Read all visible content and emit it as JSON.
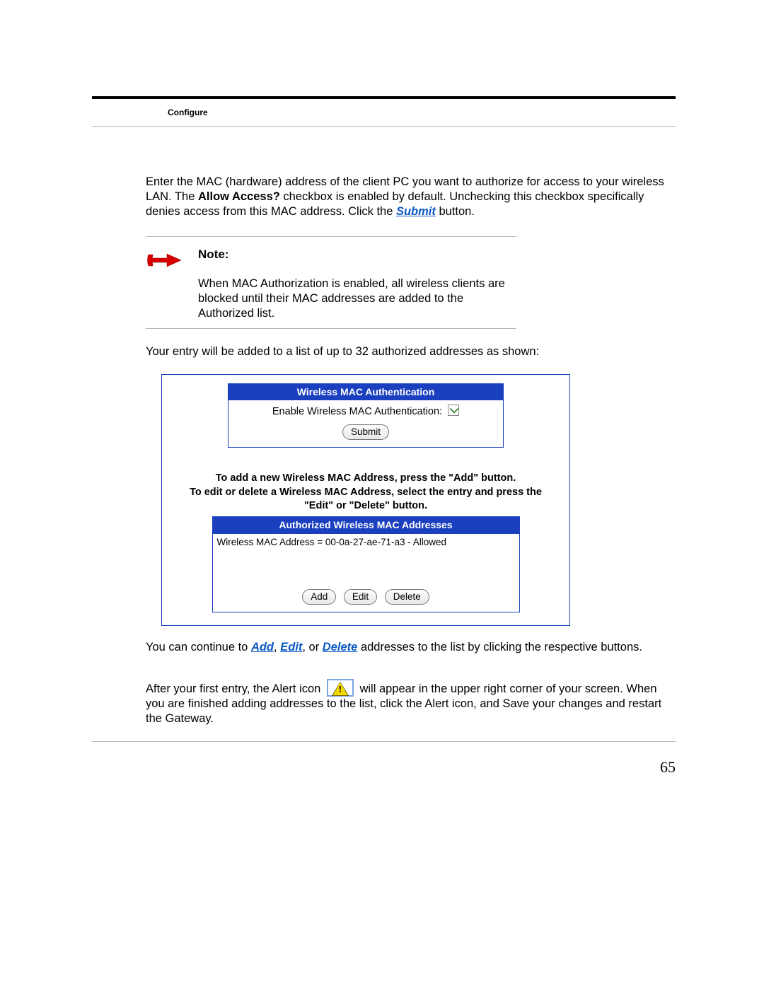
{
  "header": {
    "section": "Configure"
  },
  "para1": {
    "pre": "Enter the MAC (hardware) address of the client PC you want to authorize for access to your wireless LAN. The ",
    "bold": "Allow Access?",
    "mid": " checkbox is enabled by default. Unchecking this checkbox specifically denies access from this MAC address. Click the ",
    "action": "Submit",
    "post": " button."
  },
  "note": {
    "title": "Note:",
    "body": "When MAC Authorization is enabled, all wireless clients are blocked until their MAC addresses are added to the Authorized list."
  },
  "para2": "Your entry will be added to a list of up to 32 authorized addresses as shown:",
  "panel": {
    "box1_title": "Wireless MAC Authentication",
    "enable_label": "Enable Wireless MAC Authentication:",
    "enable_checked": true,
    "submit": "Submit",
    "instr_line1": "To add a new Wireless MAC Address, press the \"Add\" button.",
    "instr_line2": "To edit or delete a Wireless MAC Address, select the entry and press the \"Edit\" or \"Delete\" button.",
    "box2_title": "Authorized Wireless MAC Addresses",
    "entries": [
      "Wireless MAC Address = 00-0a-27-ae-71-a3 - Allowed"
    ],
    "add": "Add",
    "edit": "Edit",
    "delete": "Delete"
  },
  "para3": {
    "pre": "You can continue to ",
    "a1": "Add",
    "sep1": ", ",
    "a2": "Edit",
    "sep2": ", or ",
    "a3": "Delete",
    "post": " addresses to the list by clicking the respective buttons."
  },
  "para4": {
    "pre": "After your first entry, the Alert icon ",
    "post": " will appear in the upper right corner of your screen. When you are finished adding addresses to the list, click the Alert icon, and Save your changes and restart the Gateway."
  },
  "page_number": "65"
}
